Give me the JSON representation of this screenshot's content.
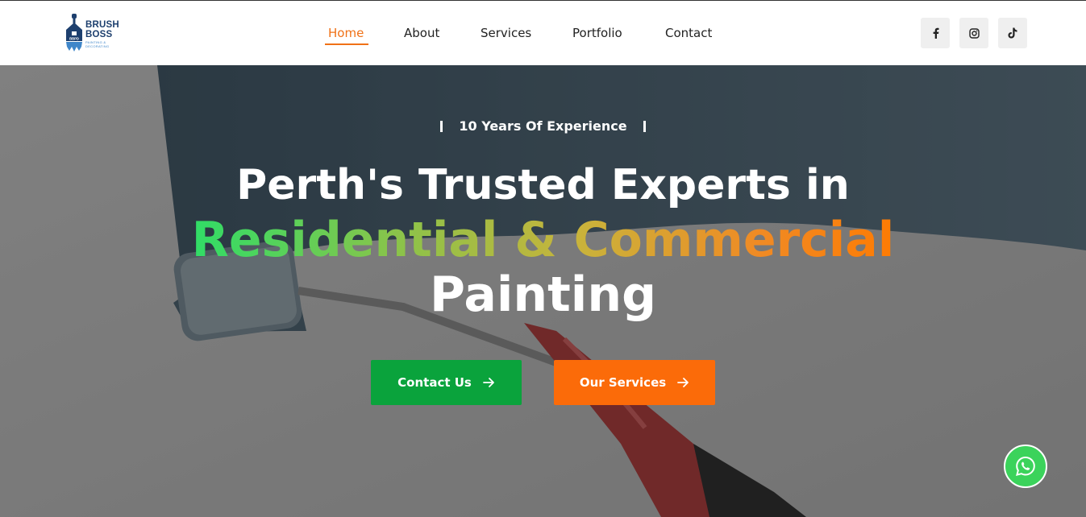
{
  "brand": {
    "name_line1": "BRUSH",
    "name_line2": "BOSS",
    "tagline": "PAINTING & DECORATING",
    "mark_initials": "BBPD",
    "primary_color": "#1d3f6e",
    "accent_color": "#3f86c9"
  },
  "nav": {
    "items": [
      {
        "label": "Home",
        "active": true
      },
      {
        "label": "About",
        "active": false
      },
      {
        "label": "Services",
        "active": false
      },
      {
        "label": "Portfolio",
        "active": false
      },
      {
        "label": "Contact",
        "active": false
      }
    ],
    "active_color": "#f07116"
  },
  "social": [
    {
      "icon": "facebook-icon"
    },
    {
      "icon": "instagram-icon"
    },
    {
      "icon": "tiktok-icon"
    }
  ],
  "hero": {
    "kicker": "10 Years Of Experience",
    "headline_line1": "Perth's Trusted Experts in",
    "headline_line2": "Residential & Commercial",
    "headline_line3": "Painting",
    "gradient_colors": [
      "#2bde68",
      "#8bc34a",
      "#c9b33b",
      "#f08a24",
      "#ff7a00"
    ]
  },
  "buttons": {
    "contact_label": "Contact Us",
    "contact_color": "#0aa33c",
    "services_label": "Our Services",
    "services_color": "#fb6b09"
  },
  "floating": {
    "icon": "whatsapp-icon",
    "color": "#3bd35b"
  }
}
